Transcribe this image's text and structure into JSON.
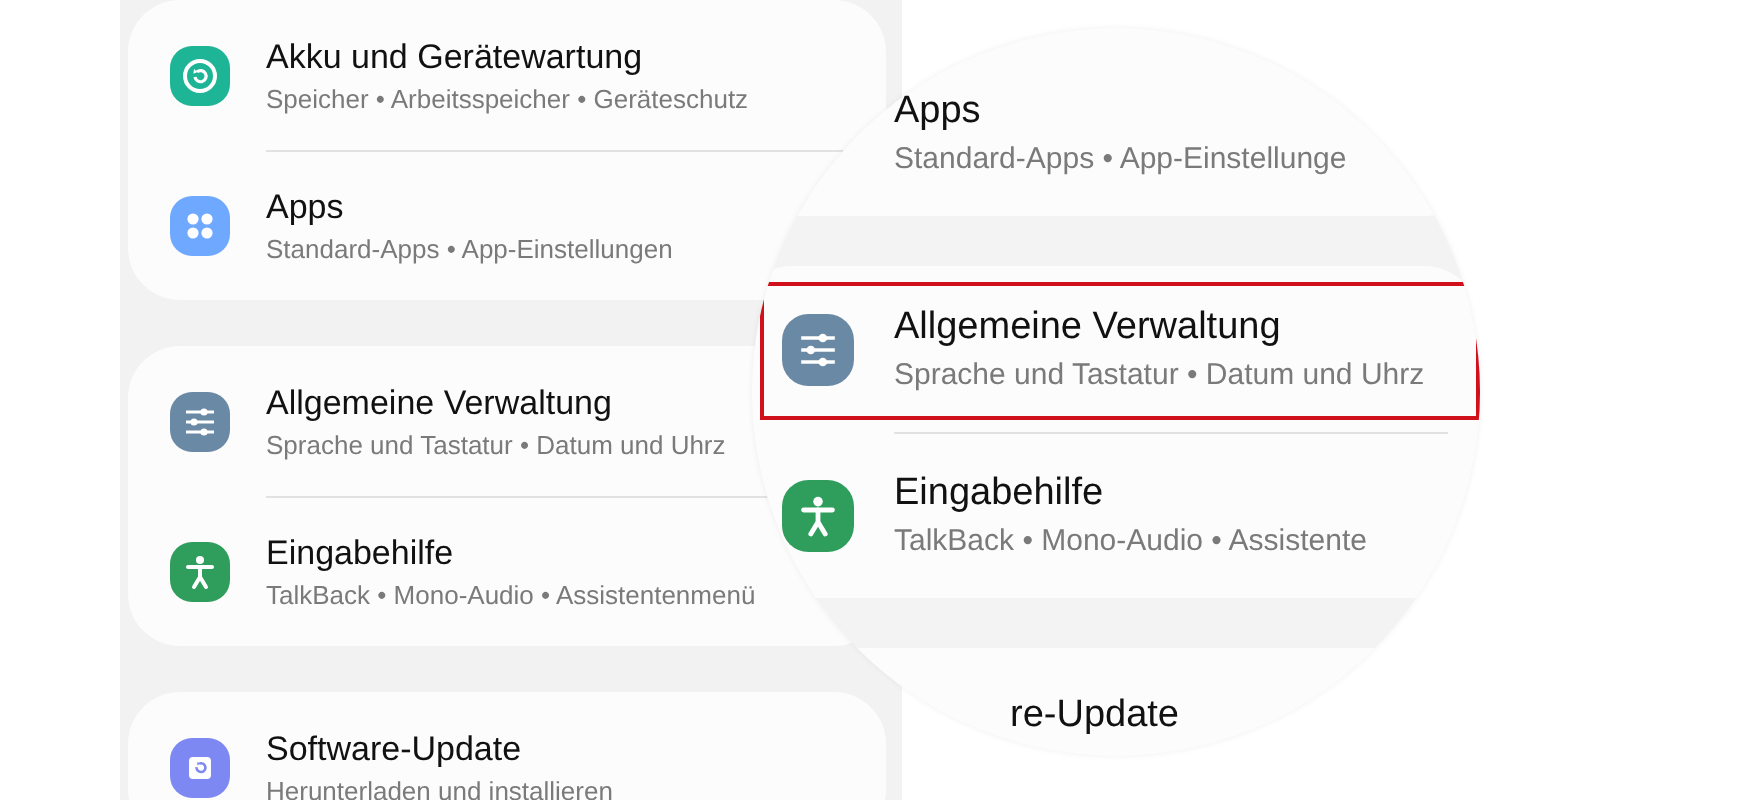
{
  "settings": {
    "groups": [
      {
        "items": [
          {
            "kind": "battery",
            "title": "Akku und Gerätewartung",
            "summary": "Speicher • Arbeitsspeicher • Geräteschutz"
          },
          {
            "kind": "apps",
            "title": "Apps",
            "summary": "Standard-Apps • App-Einstellungen"
          }
        ]
      },
      {
        "items": [
          {
            "kind": "sliders",
            "title": "Allgemeine Verwaltung",
            "summary": "Sprache und Tastatur • Datum und Uhrz"
          },
          {
            "kind": "accessibility",
            "title": "Eingabehilfe",
            "summary": "TalkBack • Mono-Audio • Assistentenmenü"
          }
        ]
      },
      {
        "items": [
          {
            "kind": "update",
            "title": "Software-Update",
            "summary": "Herunterladen und installieren"
          }
        ]
      }
    ]
  },
  "magnifier": {
    "groups": [
      {
        "items": [
          {
            "title": "Apps",
            "summary": "Standard-Apps • App-Einstellunge",
            "highlighted": false
          }
        ]
      },
      {
        "items": [
          {
            "kind": "sliders",
            "title": "Allgemeine Verwaltung",
            "summary": "Sprache und Tastatur • Datum und Uhrz",
            "highlighted": true
          },
          {
            "kind": "accessibility",
            "title": "Eingabehilfe",
            "summary": "TalkBack • Mono-Audio • Assistente",
            "highlighted": false
          }
        ]
      },
      {
        "items": [
          {
            "title": "re-Update",
            "highlighted": false
          }
        ]
      }
    ]
  }
}
